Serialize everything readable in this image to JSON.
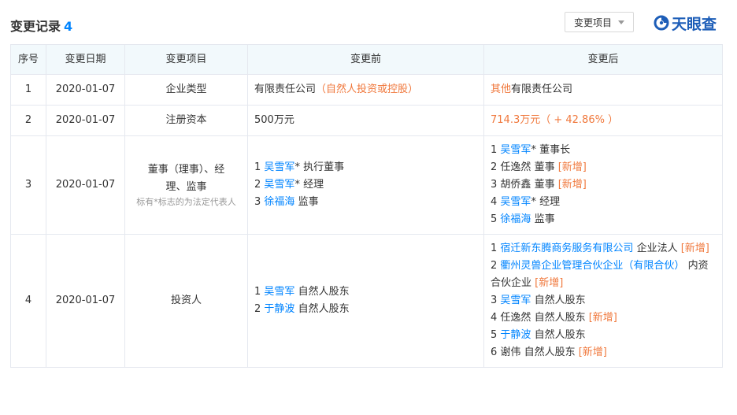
{
  "header": {
    "title": "变更记录",
    "count": "4",
    "filter_label": "变更项目",
    "logo_text": "天眼查"
  },
  "table": {
    "columns": [
      "序号",
      "变更日期",
      "变更项目",
      "变更前",
      "变更后"
    ],
    "rows": [
      {
        "index": "1",
        "date": "2020-01-07",
        "item": "企业类型",
        "before": {
          "text": "有限责任公司",
          "highlight": "（自然人投资或控股）"
        },
        "after": {
          "highlight": "其他",
          "text": "有限责任公司"
        }
      },
      {
        "index": "2",
        "date": "2020-01-07",
        "item": "注册资本",
        "before": {
          "text": "500万元"
        },
        "after": {
          "highlight": "714.3万元（ + 42.86% ）"
        }
      },
      {
        "index": "3",
        "date": "2020-01-07",
        "item": "董事（理事）、经理、监事",
        "item_note": "标有*标志的为法定代表人",
        "before": [
          {
            "num": "1",
            "name": "吴雪军",
            "suffix": "* 执行董事",
            "link": true
          },
          {
            "num": "2",
            "name": "吴雪军",
            "suffix": "* 经理",
            "link": true
          },
          {
            "num": "3",
            "name": "徐福海",
            "suffix": " 监事",
            "link": true
          }
        ],
        "after": [
          {
            "num": "1",
            "name": "吴雪军",
            "suffix": "* 董事长",
            "link": true,
            "tag": ""
          },
          {
            "num": "2",
            "name": "任逸然",
            "suffix": " 董事 ",
            "link": false,
            "tag": "[新增]"
          },
          {
            "num": "3",
            "name": "胡侨鑫",
            "suffix": " 董事 ",
            "link": false,
            "tag": "[新增]"
          },
          {
            "num": "4",
            "name": "吴雪军",
            "suffix": "* 经理",
            "link": true,
            "tag": ""
          },
          {
            "num": "5",
            "name": "徐福海",
            "suffix": " 监事",
            "link": true,
            "tag": ""
          }
        ]
      },
      {
        "index": "4",
        "date": "2020-01-07",
        "item": "投资人",
        "before": [
          {
            "num": "1",
            "name": "吴雪军",
            "suffix": " 自然人股东",
            "link": true
          },
          {
            "num": "2",
            "name": "于静波",
            "suffix": " 自然人股东",
            "link": true
          }
        ],
        "after": [
          {
            "num": "1",
            "name": "宿迁新东腾商务服务有限公司",
            "suffix": " 企业法人 ",
            "link": true,
            "tag": "[新增]"
          },
          {
            "num": "2",
            "name": "衢州灵兽企业管理合伙企业（有限合伙）",
            "suffix": " 内资合伙企业 ",
            "link": true,
            "tag": "[新增]"
          },
          {
            "num": "3",
            "name": "吴雪军",
            "suffix": " 自然人股东",
            "link": true,
            "tag": ""
          },
          {
            "num": "4",
            "name": "任逸然",
            "suffix": " 自然人股东 ",
            "link": false,
            "tag": "[新增]"
          },
          {
            "num": "5",
            "name": "于静波",
            "suffix": " 自然人股东",
            "link": true,
            "tag": ""
          },
          {
            "num": "6",
            "name": "谢伟",
            "suffix": " 自然人股东 ",
            "link": false,
            "tag": "[新增]"
          }
        ]
      }
    ]
  },
  "colors": {
    "accent": "#0084ff",
    "highlight": "#f0783c",
    "header_bg": "#f2f9fc",
    "border": "#e5e8ef",
    "logo": "#1e5eb8"
  },
  "icons": {
    "logo": "tianyancha-logo-icon",
    "filter": "caret-down-icon"
  }
}
